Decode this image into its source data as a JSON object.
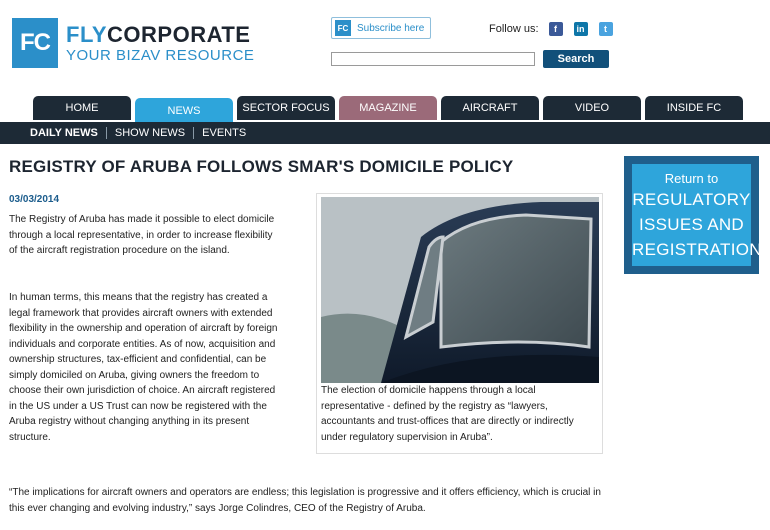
{
  "header": {
    "logo_mark": "FC",
    "logo_fly": "FLY",
    "logo_corporate": "CORPORATE",
    "tagline": "YOUR BIZAV RESOURCE",
    "subscribe_mark": "FC",
    "subscribe_label": "Subscribe here",
    "follow_label": "Follow us:",
    "social": [
      "f",
      "in",
      "t"
    ],
    "search_placeholder": "",
    "search_button": "Search"
  },
  "nav": {
    "tabs": [
      {
        "label": "HOME"
      },
      {
        "label": "NEWS"
      },
      {
        "label": "SECTOR FOCUS"
      },
      {
        "label": "MAGAZINE"
      },
      {
        "label": "AIRCRAFT"
      },
      {
        "label": "VIDEO"
      },
      {
        "label": "INSIDE FC"
      }
    ],
    "subnav": [
      "DAILY NEWS",
      "SHOW NEWS",
      "EVENTS"
    ]
  },
  "article": {
    "headline": "REGISTRY OF ARUBA FOLLOWS SMAR'S DOMICILE POLICY",
    "date": "03/03/2014",
    "paragraphs": [
      "The Registry of Aruba has made it possible to elect domicile through a local representative, in order to increase flexibility of the aircraft registration procedure on the island.",
      "In human terms, this means that the registry has created a legal framework that provides aircraft owners with extended flexibility in the ownership and operation of aircraft by foreign individuals and corporate entities. As of now, acquisition and ownership structures, tax-efficient and confidential, can be simply domiciled on Aruba, giving owners the freedom to choose their own jurisdiction of choice. An aircraft registered in the US under a US Trust can now be registered with the Aruba registry without changing anything in its present structure.",
      "“The implications for aircraft owners and operators are endless; this legislation is progressive and it offers efficiency, which is crucial in this ever changing and evolving industry,” says Jorge Colindres, CEO of the Registry of Aruba."
    ],
    "caption": "The election of domicile happens through a local representative - defined by the registry as “lawyers, accountants and trust-offices that are directly or indirectly under regulatory supervision in Aruba”."
  },
  "sidebar": {
    "return_label": "Return to",
    "link_line1": "REGULATORY",
    "link_line2": "ISSUES AND",
    "link_line3": "REGISTRATION"
  },
  "colors": {
    "brand_blue": "#2b8fc9",
    "nav_dark": "#1d2a36",
    "nav_active": "#2ea5db",
    "nav_magazine": "#9b6a79"
  }
}
